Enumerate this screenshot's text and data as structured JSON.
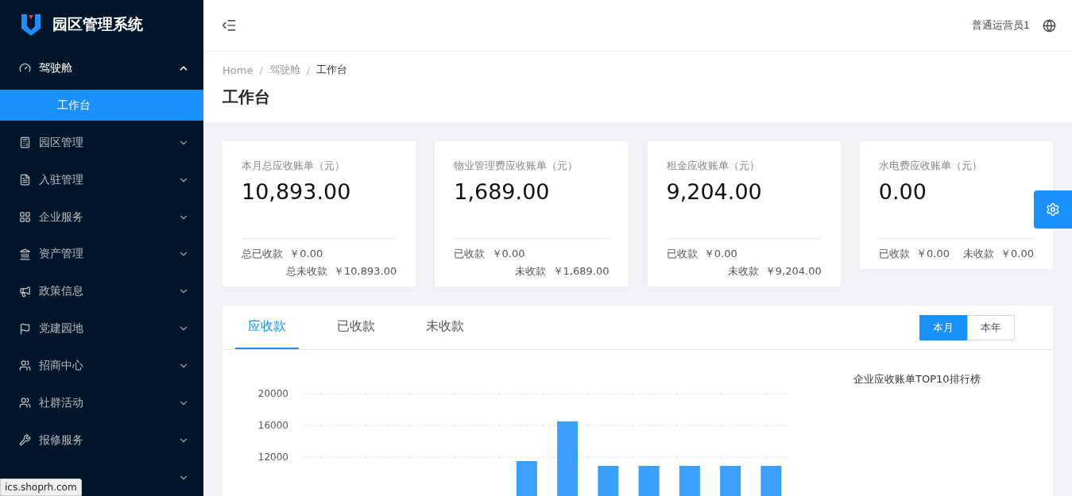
{
  "sidebar": {
    "brand": "园区管理系统",
    "menu": [
      {
        "label": "驾驶舱",
        "expanded": true,
        "children": [
          {
            "label": "工作台",
            "selected": true
          }
        ]
      },
      {
        "label": "园区管理",
        "expanded": false
      },
      {
        "label": "入驻管理",
        "expanded": false
      },
      {
        "label": "企业服务",
        "expanded": false
      },
      {
        "label": "资产管理",
        "expanded": false
      },
      {
        "label": "政策信息",
        "expanded": false
      },
      {
        "label": "党建园地",
        "expanded": false
      },
      {
        "label": "招商中心",
        "expanded": false
      },
      {
        "label": "社群活动",
        "expanded": false
      },
      {
        "label": "报修服务",
        "expanded": false
      },
      {
        "expanded": false
      }
    ]
  },
  "header": {
    "user": "普通运营员1"
  },
  "breadcrumb": {
    "separator": "/",
    "items": [
      "Home",
      "驾驶舱",
      "工作台"
    ]
  },
  "page_title": "工作台",
  "stats": [
    {
      "kind": "full",
      "title": "本月总应收账单（元）",
      "value": "10,893.00",
      "received_label": "总已收款",
      "received": "￥0.00",
      "unpaid_label": "总未收款",
      "unpaid": "￥10,893.00"
    },
    {
      "kind": "full",
      "title": "物业管理费应收账单（元）",
      "value": "1,689.00",
      "received_label": "已收款",
      "received": "￥0.00",
      "unpaid_label": "未收款",
      "unpaid": "￥1,689.00"
    },
    {
      "kind": "full",
      "title": "租金应收账单（元）",
      "value": "9,204.00",
      "received_label": "已收款",
      "received": "￥0.00",
      "unpaid_label": "未收款",
      "unpaid": "￥9,204.00"
    },
    {
      "kind": "compact",
      "title": "水电费应收账单（元）",
      "value": "0.00",
      "received_label": "已收款",
      "received": "￥0.00",
      "unpaid_label": "未收款",
      "unpaid": "￥0.00"
    }
  ],
  "chart_card": {
    "tabs": [
      {
        "label": "应收款",
        "selected": true
      },
      {
        "label": "已收款",
        "selected": false
      },
      {
        "label": "未收款",
        "selected": false
      }
    ],
    "periods": [
      {
        "label": "本月",
        "selected": true
      },
      {
        "label": "本年",
        "selected": false
      }
    ],
    "ranking_title": "企业应收账单TOP10排行榜",
    "chart_data": {
      "type": "bar",
      "ylim": [
        0,
        20000
      ],
      "yticks": [
        12000,
        16000,
        20000
      ],
      "series": [
        {
          "color": "#3aa0ff",
          "values": [
            0,
            0,
            0,
            0,
            0,
            11500,
            16500,
            10900,
            10900,
            10900,
            10900,
            10900
          ]
        }
      ]
    }
  },
  "status_url": "ics.shoprh.com"
}
